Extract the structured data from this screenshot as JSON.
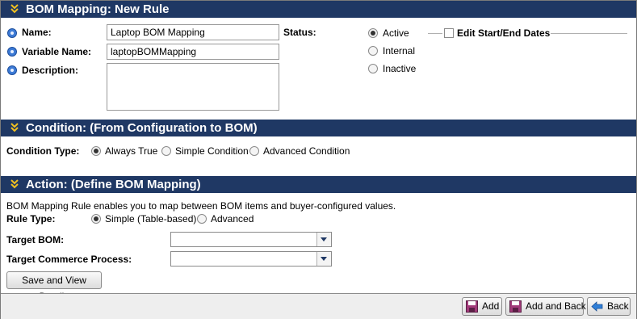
{
  "rule_section": {
    "title": "BOM Mapping: New Rule",
    "name_label": "Name:",
    "name_value": "Laptop BOM Mapping",
    "variable_label": "Variable Name:",
    "variable_value": "laptopBOMMapping",
    "description_label": "Description:",
    "description_value": "",
    "status_label": "Status:",
    "status_options": [
      "Active",
      "Internal",
      "Inactive"
    ],
    "status_selected": "Active",
    "edit_dates_label": "Edit Start/End Dates"
  },
  "condition_section": {
    "title": "Condition: (From Configuration to BOM)",
    "type_label": "Condition Type:",
    "options": [
      "Always True",
      "Simple Condition",
      "Advanced Condition"
    ],
    "selected": "Always True"
  },
  "action_section": {
    "title": "Action: (Define BOM Mapping)",
    "info_text": "BOM Mapping Rule enables you to map between BOM items and buyer-configured values.",
    "rule_type_label": "Rule Type:",
    "rule_type_options": [
      "Simple (Table-based)",
      "Advanced"
    ],
    "rule_type_selected": "Simple (Table-based)",
    "target_bom_label": "Target BOM:",
    "target_bom_value": "",
    "target_process_label": "Target Commerce Process:",
    "target_process_value": "",
    "save_view_label": "Save and View Details"
  },
  "footer": {
    "add_label": "Add",
    "add_back_label": "Add and Back",
    "back_label": "Back"
  },
  "colors": {
    "header_bg": "#1f3864",
    "header_text": "#ffffff",
    "chevron": "#f0c020"
  }
}
